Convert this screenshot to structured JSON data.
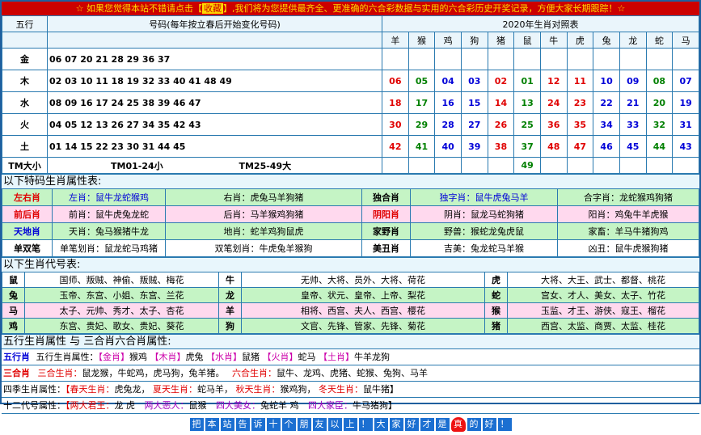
{
  "banner": {
    "prefix": "☆ 如果您觉得本站不错请点击【",
    "highlight": "收藏",
    "suffix": "】,我们将为您提供最齐全、更准确的六合彩数据与实用的六合彩历史开奖记录，方便大家长期跟踪！☆"
  },
  "header": {
    "c1": "五行",
    "c2": "号码(每年按立春后开始变化号码)",
    "c3": "2020年生肖对照表"
  },
  "zodiac_header": [
    "羊",
    "猴",
    "鸡",
    "狗",
    "猪",
    "鼠",
    "牛",
    "虎",
    "兔",
    "龙",
    "蛇",
    "马"
  ],
  "rows": [
    {
      "el": "金",
      "nums": "06 07 20 21 28 29 36 37",
      "vals": [
        "",
        "",
        "",
        "",
        "",
        "",
        "",
        "",
        "",
        "",
        "",
        ""
      ]
    },
    {
      "el": "木",
      "nums": "02 03 10 11 18 19 32 33 40 41 48 49",
      "vals": [
        "06",
        "05",
        "04",
        "03",
        "02",
        "01",
        "12",
        "11",
        "10",
        "09",
        "08",
        "07"
      ]
    },
    {
      "el": "水",
      "nums": "08 09 16 17 24 25 38 39 46 47",
      "vals": [
        "18",
        "17",
        "16",
        "15",
        "14",
        "13",
        "24",
        "23",
        "22",
        "21",
        "20",
        "19"
      ]
    },
    {
      "el": "火",
      "nums": "04 05 12 13 26 27 34 35 42 43",
      "vals": [
        "30",
        "29",
        "28",
        "27",
        "26",
        "25",
        "36",
        "35",
        "34",
        "33",
        "32",
        "31"
      ]
    },
    {
      "el": "土",
      "nums": "01 14 15 22 23 30 31 44 45",
      "vals": [
        "42",
        "41",
        "40",
        "39",
        "38",
        "37",
        "48",
        "47",
        "46",
        "45",
        "44",
        "43"
      ]
    }
  ],
  "tm": {
    "a": "TM大小",
    "b": "TM01-24小",
    "c": "TM25-49大",
    "extra": "49"
  },
  "sec1": "以下特码生肖属性表:",
  "attr1": [
    [
      "左右肖",
      "左肖：鼠牛龙蛇猴鸡",
      "右肖：虎兔马羊狗猪",
      "独合肖",
      "独字肖：鼠牛虎兔马羊",
      "合字肖：龙蛇猴鸡狗猪"
    ],
    [
      "前后肖",
      "前肖：鼠牛虎兔龙蛇",
      "后肖：马羊猴鸡狗猪",
      "阴阳肖",
      "阴肖：鼠龙马蛇狗猪",
      "阳肖：鸡兔牛羊虎猴"
    ],
    [
      "天地肖",
      "天肖：兔马猴猪牛龙",
      "地肖：蛇羊鸡狗鼠虎",
      "家野肖",
      "野兽：猴蛇龙兔虎鼠",
      "家畜：羊马牛猪狗鸡"
    ],
    [
      "单双笔",
      "单笔划肖：鼠龙蛇马鸡猪",
      "双笔划肖：牛虎兔羊猴狗",
      "美丑肖",
      "吉美：兔龙蛇马羊猴",
      "凶丑：鼠牛虎猴狗猪"
    ]
  ],
  "sec2": "以下生肖代号表:",
  "daihao": [
    [
      "鼠",
      "国师、叛贼、神偷、叛贼、梅花",
      "牛",
      "无帅、大将、员外、大将、荷花",
      "虎",
      "大将、大王、武士、都督、桃花"
    ],
    [
      "兔",
      "玉帝、东宫、小姐、东宫、兰花",
      "龙",
      "皇帝、状元、皇帝、上帝、梨花",
      "蛇",
      "宫女、才人、美女、太子、竹花"
    ],
    [
      "马",
      "太子、元帅、秀才、太子、杏花",
      "羊",
      "相将、西宫、夫人、西宫、樱花",
      "猴",
      "玉监、才王、游侠、寇王、榴花"
    ],
    [
      "鸡",
      "东宫、贵妃、歌女、贵妃、葵花",
      "狗",
      "文官、先锋、管家、先锋、菊花",
      "猪",
      "西宫、太监、商贾、太监、桂花"
    ]
  ],
  "sec3": "五行生肖属性 与 三合肖六合肖属性:",
  "wx_label": "五行肖",
  "wx_text": [
    "五行生肖属性：",
    "【金肖】",
    "猴鸡",
    "【木肖】",
    "虎兔",
    "【水肖】",
    "鼠猪",
    "【火肖】",
    "蛇马",
    "【土肖】",
    "牛羊龙狗"
  ],
  "sanhe_label": "三合肖",
  "sanhe_text": [
    "三合生肖：",
    "鼠龙猴，牛蛇鸡，虎马狗，兔羊猪。",
    "六合生肖：",
    "鼠牛、龙鸡、虎猪、蛇猴、兔狗、马羊"
  ],
  "siji": [
    "四季生肖属性：",
    "【春天生肖：",
    "虎兔龙，",
    "夏天生肖：",
    "蛇马羊，",
    "秋天生肖：",
    "猴鸡狗，",
    "冬天生肖：",
    "鼠牛猪】"
  ],
  "shier": [
    "十二代号属性：",
    "【两大君王：",
    "龙 虎",
    "两大恶人：",
    "鼠猴",
    "四大美女：",
    "兔蛇羊 鸡",
    "四大家臣：",
    "牛马猪狗】"
  ],
  "footer": [
    "把",
    "本",
    "站",
    "告",
    "诉",
    "十",
    "个",
    "朋",
    "友",
    "以",
    "上",
    "！",
    "大",
    "家",
    "好",
    "才",
    "是",
    "真",
    "的",
    "好",
    "！"
  ],
  "colors": {
    "accent": "#cc0000",
    "border": "#2a7ab0",
    "footer_box": "#1b6fd1"
  }
}
